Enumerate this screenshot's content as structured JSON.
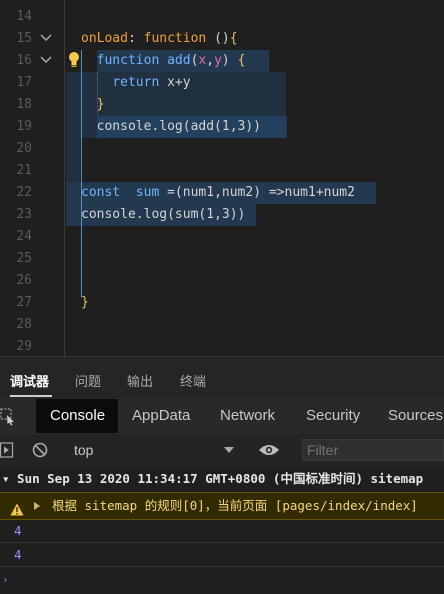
{
  "editor": {
    "lines": [
      {
        "num": "14"
      },
      {
        "num": "15",
        "fold": true,
        "code": [
          {
            "t": "onLoad",
            "c": "kw"
          },
          {
            "t": ": ",
            "c": "txt"
          },
          {
            "t": "function",
            "c": "kw"
          },
          {
            "t": " ()",
            "c": "txt"
          },
          {
            "t": "{",
            "c": "brace"
          }
        ]
      },
      {
        "num": "16",
        "fold": true,
        "code": [
          {
            "t": "  ",
            "c": "txt"
          },
          {
            "t": "function",
            "c": "fn"
          },
          {
            "t": " ",
            "c": "txt"
          },
          {
            "t": "add",
            "c": "fn"
          },
          {
            "t": "(",
            "c": "txt"
          },
          {
            "t": "x",
            "c": "par"
          },
          {
            "t": ",",
            "c": "txt"
          },
          {
            "t": "y",
            "c": "par"
          },
          {
            "t": ") ",
            "c": "txt"
          },
          {
            "t": "{",
            "c": "brace"
          }
        ]
      },
      {
        "num": "17",
        "code": [
          {
            "t": "    ",
            "c": "txt"
          },
          {
            "t": "return",
            "c": "ret"
          },
          {
            "t": " x+y",
            "c": "txt"
          }
        ]
      },
      {
        "num": "18",
        "code": [
          {
            "t": "  ",
            "c": "txt"
          },
          {
            "t": "}",
            "c": "brace"
          }
        ]
      },
      {
        "num": "19",
        "code": [
          {
            "t": "  console.log(add(1,3))",
            "c": "txt"
          }
        ]
      },
      {
        "num": "20"
      },
      {
        "num": "21"
      },
      {
        "num": "22",
        "code": [
          {
            "t": "const",
            "c": "fn"
          },
          {
            "t": "  ",
            "c": "txt"
          },
          {
            "t": "sum",
            "c": "fn"
          },
          {
            "t": " =(num1,num2) =>num1+num2",
            "c": "txt"
          }
        ]
      },
      {
        "num": "23",
        "code": [
          {
            "t": "console.log(sum(1,3))",
            "c": "txt"
          }
        ]
      },
      {
        "num": "24"
      },
      {
        "num": "25"
      },
      {
        "num": "26"
      },
      {
        "num": "27",
        "code": [
          {
            "t": "}",
            "c": "brace"
          }
        ]
      },
      {
        "num": "28"
      },
      {
        "num": "29"
      }
    ]
  },
  "panel": {
    "tabs": [
      "调试器",
      "问题",
      "输出",
      "终端"
    ]
  },
  "devtools": {
    "tabs": [
      "Console",
      "AppData",
      "Network",
      "Security",
      "Sources"
    ]
  },
  "toolbar": {
    "context": "top",
    "filter_placeholder": "Filter"
  },
  "console": {
    "date_line": "▾ Sun Sep 13 2020 11:34:17 GMT+0800 (中国标准时间) sitemap",
    "warning_line": "根据 sitemap 的规则[0]，当前页面 [pages/index/index]",
    "outputs": [
      "4",
      "4"
    ]
  },
  "colors": {
    "keyword": "#f0a23a",
    "function": "#6fb4ff",
    "param": "#e06c9f",
    "selection": "#264f78",
    "warning_bg": "#332b00",
    "log_number": "#8f95ff"
  }
}
